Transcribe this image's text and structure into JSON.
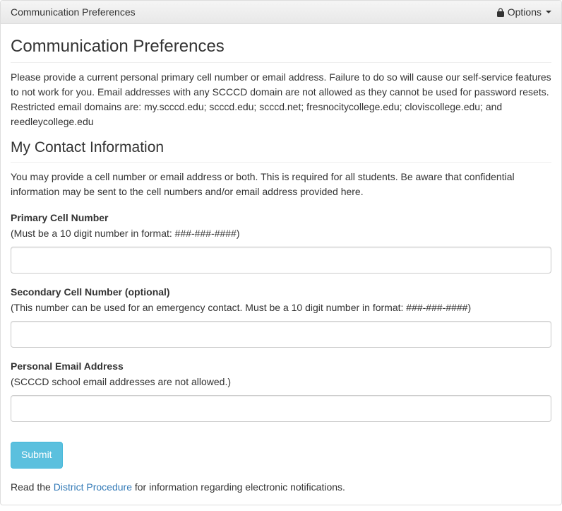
{
  "header": {
    "title": "Communication Preferences",
    "options_label": "Options"
  },
  "main": {
    "heading": "Communication Preferences",
    "intro": "Please provide a current personal primary cell number or email address. Failure to do so will cause our self-service features to not work for you. Email addresses with any SCCCD domain are not allowed as they cannot be used for password resets. Restricted email domains are: my.scccd.edu; scccd.edu; scccd.net; fresnocitycollege.edu; cloviscollege.edu; and reedleycollege.edu",
    "section_heading": "My Contact Information",
    "section_intro": "You may provide a cell number or email address or both. This is required for all students. Be aware that confidential information may be sent to the cell numbers and/or email address provided here.",
    "fields": {
      "primary": {
        "label": "Primary Cell Number",
        "hint": "(Must be a 10 digit number in format: ###-###-####)",
        "value": ""
      },
      "secondary": {
        "label": "Secondary Cell Number (optional)",
        "hint": "(This number can be used for an emergency contact. Must be a 10 digit number in format: ###-###-####)",
        "value": ""
      },
      "email": {
        "label": "Personal Email Address",
        "hint": "(SCCCD school email addresses are not allowed.)",
        "value": ""
      }
    },
    "submit_label": "Submit",
    "footer_prefix": "Read the ",
    "footer_link": "District Procedure",
    "footer_suffix": " for information regarding electronic notifications."
  }
}
